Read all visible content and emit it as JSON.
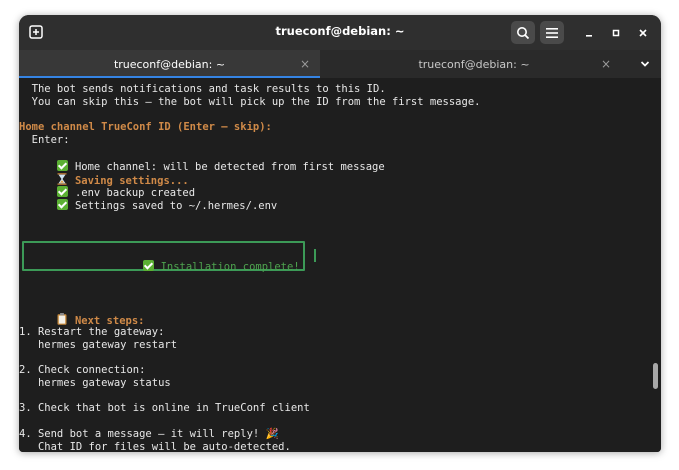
{
  "window": {
    "title": "trueconf@debian: ~"
  },
  "tabs": [
    {
      "label": "trueconf@debian: ~",
      "close": "×",
      "active": true
    },
    {
      "label": "trueconf@debian: ~",
      "close": "×",
      "active": false
    }
  ],
  "terminal": {
    "cut_line": "   ̣̣̣ ̣",
    "line1": "  The bot sends notifications and task results to this ID.",
    "line2": "  You can skip this — the bot will pick up the ID from the first message.",
    "home_prompt": "Home channel TrueConf ID (Enter — skip):",
    "enter_line": "  Enter:",
    "home_detect": "Home channel: will be detected from first message",
    "saving": "Saving settings...",
    "env_backup": ".env backup created",
    "settings_saved": "Settings saved to ~/.hermes/.env",
    "install_complete": "Installation complete!",
    "next_steps": "Next steps:",
    "step1": "1. Restart the gateway:",
    "step1_cmd": "   hermes gateway restart",
    "step2": "2. Check connection:",
    "step2_cmd": "   hermes gateway status",
    "step3": "3. Check that bot is online in TrueConf client",
    "step4": "4. Send bot a message — it will reply! 🎉",
    "step4_note": "   Chat ID for files will be auto-detected."
  }
}
